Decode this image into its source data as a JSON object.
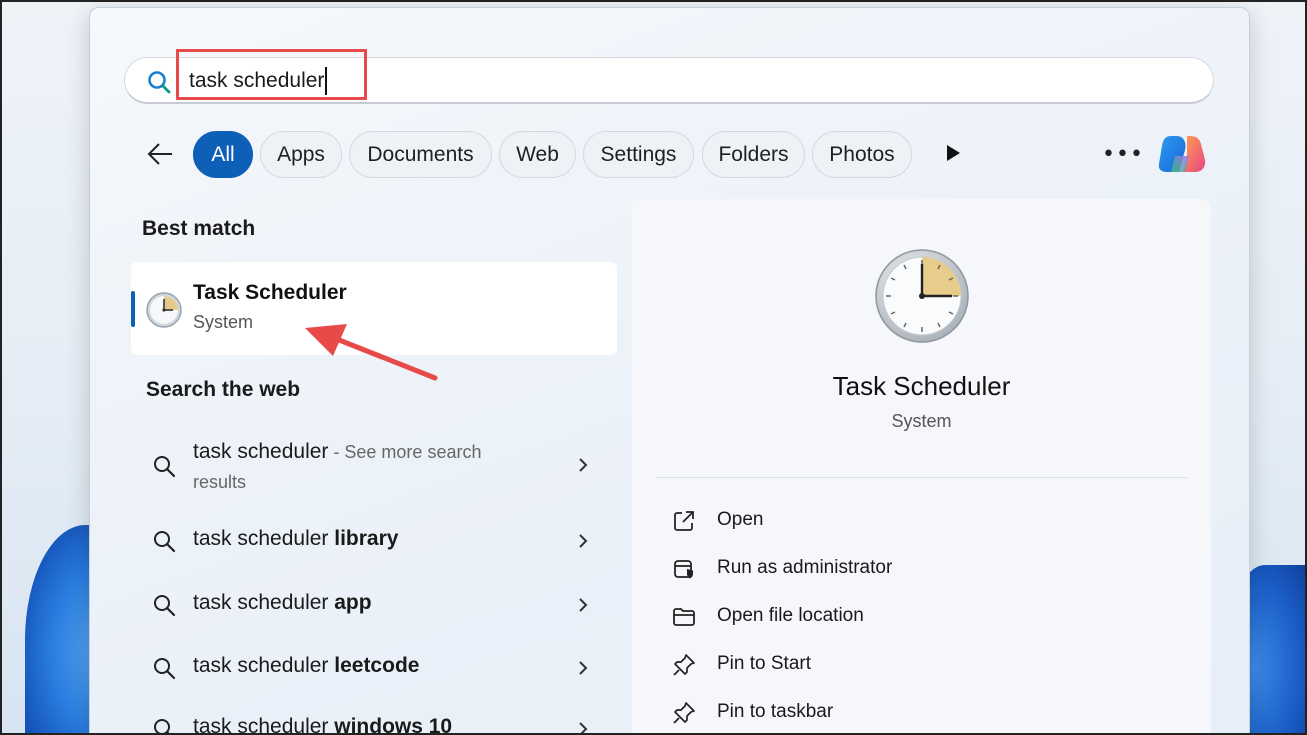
{
  "search": {
    "query": "task scheduler"
  },
  "filters": [
    {
      "label": "All",
      "active": true
    },
    {
      "label": "Apps"
    },
    {
      "label": "Documents"
    },
    {
      "label": "Web"
    },
    {
      "label": "Settings"
    },
    {
      "label": "Folders"
    },
    {
      "label": "Photos"
    }
  ],
  "best_match": {
    "heading": "Best match",
    "title": "Task Scheduler",
    "subtitle": "System"
  },
  "web": {
    "heading": "Search the web",
    "items": [
      {
        "query": "task scheduler",
        "suffix": " - See more search",
        "suffix2": "results"
      },
      {
        "query": "task scheduler ",
        "bold": "library"
      },
      {
        "query": "task scheduler ",
        "bold": "app"
      },
      {
        "query": "task scheduler ",
        "bold": "leetcode"
      },
      {
        "query": "task scheduler ",
        "bold": "windows 10"
      }
    ]
  },
  "detail": {
    "title": "Task Scheduler",
    "subtitle": "System",
    "actions": [
      {
        "label": "Open",
        "icon": "open-external-icon"
      },
      {
        "label": "Run as administrator",
        "icon": "shield-admin-icon"
      },
      {
        "label": "Open file location",
        "icon": "folder-icon"
      },
      {
        "label": "Pin to Start",
        "icon": "pin-icon"
      },
      {
        "label": "Pin to taskbar",
        "icon": "pin-icon"
      }
    ]
  },
  "colors": {
    "accent": "#0e5fb8",
    "highlight": "#e84a4a"
  }
}
